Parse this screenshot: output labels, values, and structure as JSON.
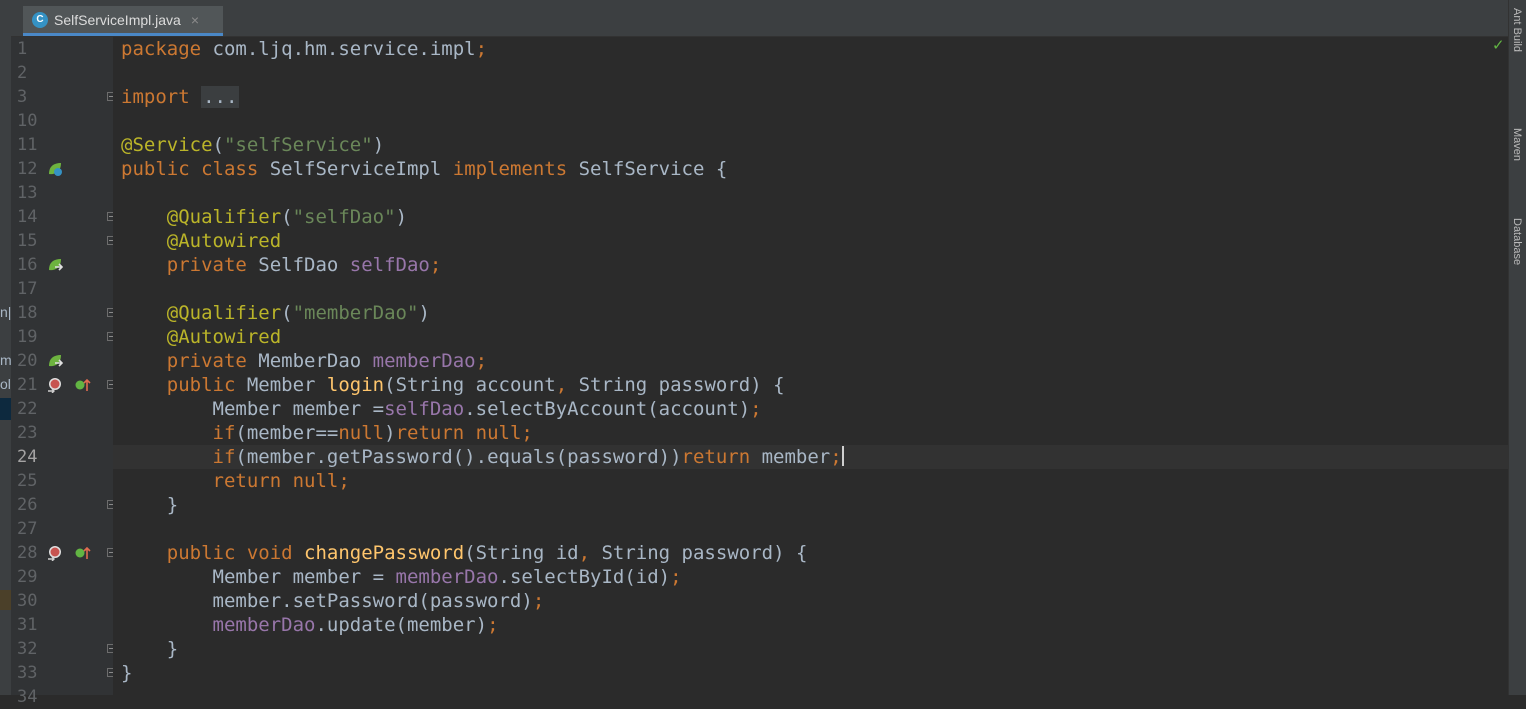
{
  "tab": {
    "icon_letter": "C",
    "label": "SelfServiceImpl.java",
    "close": "×"
  },
  "side_panel": {
    "fragments": [
      "n|",
      "m",
      "ol"
    ]
  },
  "right_toolbar": {
    "items": [
      "Ant Build",
      "Maven",
      "Database"
    ]
  },
  "status": {
    "inspection": "✓"
  },
  "gutter": {
    "line_numbers": [
      "1",
      "2",
      "3",
      "10",
      "11",
      "12",
      "13",
      "14",
      "15",
      "16",
      "17",
      "18",
      "19",
      "20",
      "21",
      "22",
      "23",
      "24",
      "25",
      "26",
      "27",
      "28",
      "29",
      "30",
      "31",
      "32",
      "33",
      "34"
    ],
    "current_line": "24"
  },
  "code": [
    [
      [
        "kw",
        "package "
      ],
      [
        "plain",
        "com.ljq.hm.service.impl"
      ],
      [
        "kw",
        ";"
      ]
    ],
    [],
    [
      [
        "kw",
        "import "
      ],
      [
        "fold",
        "..."
      ]
    ],
    [],
    [
      [
        "ann",
        "@Service"
      ],
      [
        "plain",
        "("
      ],
      [
        "str",
        "\"selfService\""
      ],
      [
        "plain",
        ")"
      ]
    ],
    [
      [
        "kw",
        "public class "
      ],
      [
        "plain",
        "SelfServiceImpl "
      ],
      [
        "kw",
        "implements "
      ],
      [
        "plain",
        "SelfService {"
      ]
    ],
    [],
    [
      [
        "plain",
        "    "
      ],
      [
        "ann",
        "@Qualifier"
      ],
      [
        "plain",
        "("
      ],
      [
        "str",
        "\"selfDao\""
      ],
      [
        "plain",
        ")"
      ]
    ],
    [
      [
        "plain",
        "    "
      ],
      [
        "ann",
        "@Autowired"
      ]
    ],
    [
      [
        "plain",
        "    "
      ],
      [
        "kw",
        "private "
      ],
      [
        "plain",
        "SelfDao "
      ],
      [
        "field",
        "selfDao"
      ],
      [
        "kw",
        ";"
      ]
    ],
    [],
    [
      [
        "plain",
        "    "
      ],
      [
        "ann",
        "@Qualifier"
      ],
      [
        "plain",
        "("
      ],
      [
        "str",
        "\"memberDao\""
      ],
      [
        "plain",
        ")"
      ]
    ],
    [
      [
        "plain",
        "    "
      ],
      [
        "ann",
        "@Autowired"
      ]
    ],
    [
      [
        "plain",
        "    "
      ],
      [
        "kw",
        "private "
      ],
      [
        "plain",
        "MemberDao "
      ],
      [
        "field",
        "memberDao"
      ],
      [
        "kw",
        ";"
      ]
    ],
    [
      [
        "plain",
        "    "
      ],
      [
        "kw",
        "public "
      ],
      [
        "plain",
        "Member "
      ],
      [
        "fn",
        "login"
      ],
      [
        "plain",
        "(String account"
      ],
      [
        "kw",
        ", "
      ],
      [
        "plain",
        "String password) {"
      ]
    ],
    [
      [
        "plain",
        "        Member member ="
      ],
      [
        "field",
        "selfDao"
      ],
      [
        "plain",
        ".selectByAccount(account)"
      ],
      [
        "kw",
        ";"
      ]
    ],
    [
      [
        "plain",
        "        "
      ],
      [
        "kw",
        "if"
      ],
      [
        "plain",
        "(member=="
      ],
      [
        "kw",
        "null"
      ],
      [
        "plain",
        ")"
      ],
      [
        "kw",
        "return null;"
      ]
    ],
    [
      [
        "plain",
        "        "
      ],
      [
        "kw",
        "if"
      ],
      [
        "plain",
        "(member.getPassword().equals(password))"
      ],
      [
        "kw",
        "return "
      ],
      [
        "plain",
        "member"
      ],
      [
        "kw",
        ";"
      ]
    ],
    [
      [
        "plain",
        "        "
      ],
      [
        "kw",
        "return null;"
      ]
    ],
    [
      [
        "plain",
        "    }"
      ]
    ],
    [],
    [
      [
        "plain",
        "    "
      ],
      [
        "kw",
        "public void "
      ],
      [
        "fn",
        "changePassword"
      ],
      [
        "plain",
        "(String id"
      ],
      [
        "kw",
        ", "
      ],
      [
        "plain",
        "String password) {"
      ]
    ],
    [
      [
        "plain",
        "        Member member = "
      ],
      [
        "field",
        "memberDao"
      ],
      [
        "plain",
        ".selectById(id)"
      ],
      [
        "kw",
        ";"
      ]
    ],
    [
      [
        "plain",
        "        member.setPassword(password)"
      ],
      [
        "kw",
        ";"
      ]
    ],
    [
      [
        "plain",
        "        "
      ],
      [
        "field",
        "memberDao"
      ],
      [
        "plain",
        ".update(member)"
      ],
      [
        "kw",
        ";"
      ]
    ],
    [
      [
        "plain",
        "    }"
      ]
    ],
    [
      [
        "plain",
        "}"
      ]
    ],
    []
  ]
}
